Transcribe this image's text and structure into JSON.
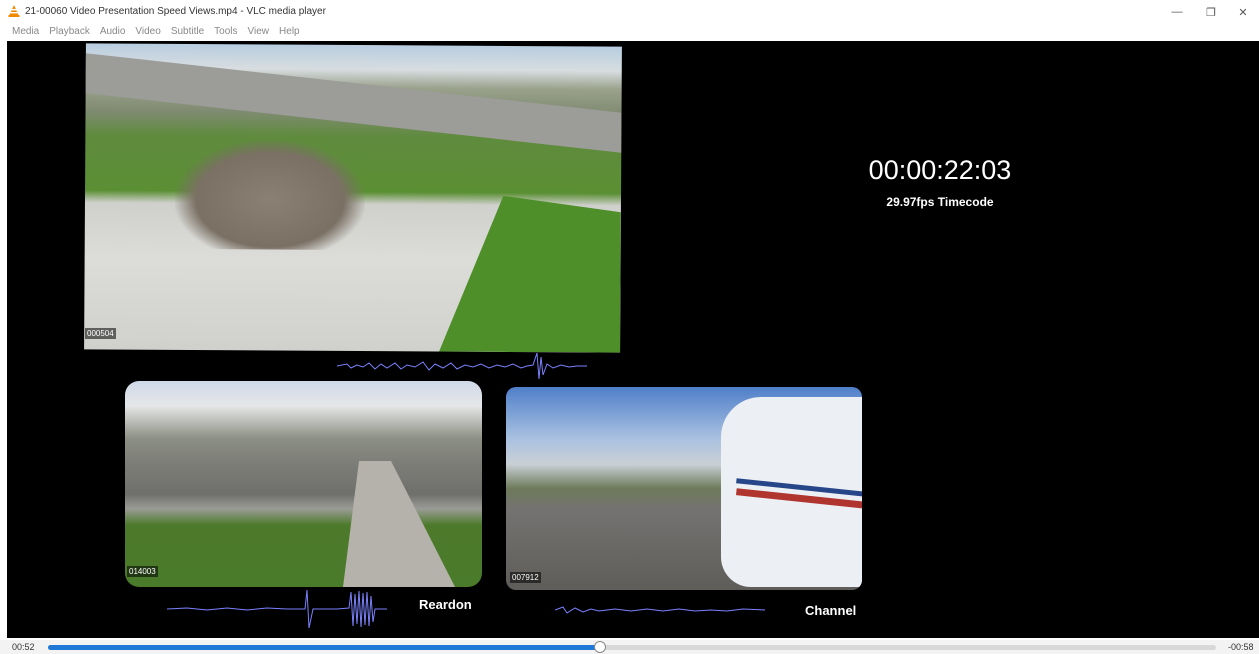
{
  "window": {
    "title": "21-00060 Video Presentation Speed Views.mp4 - VLC media player",
    "app_icon": "vlc-cone-icon",
    "controls": {
      "minimize": "—",
      "maximize": "❐",
      "close": "✕"
    }
  },
  "menu": [
    "Media",
    "Playback",
    "Audio",
    "Video",
    "Subtitle",
    "Tools",
    "View",
    "Help"
  ],
  "video": {
    "timecode": "00:00:22:03",
    "timecode_caption": "29.97fps Timecode",
    "cameras": [
      {
        "id": "000504",
        "label": ""
      },
      {
        "id": "014003",
        "label": "Reardon"
      },
      {
        "id": "007912",
        "label": "Channel"
      }
    ]
  },
  "seek": {
    "elapsed": "00:52",
    "remaining": "-00:58",
    "progress": 0.473
  },
  "colors": {
    "accent": "#1e78d6",
    "waveform": "#7b82ff",
    "vlc_orange": "#f08a00"
  }
}
